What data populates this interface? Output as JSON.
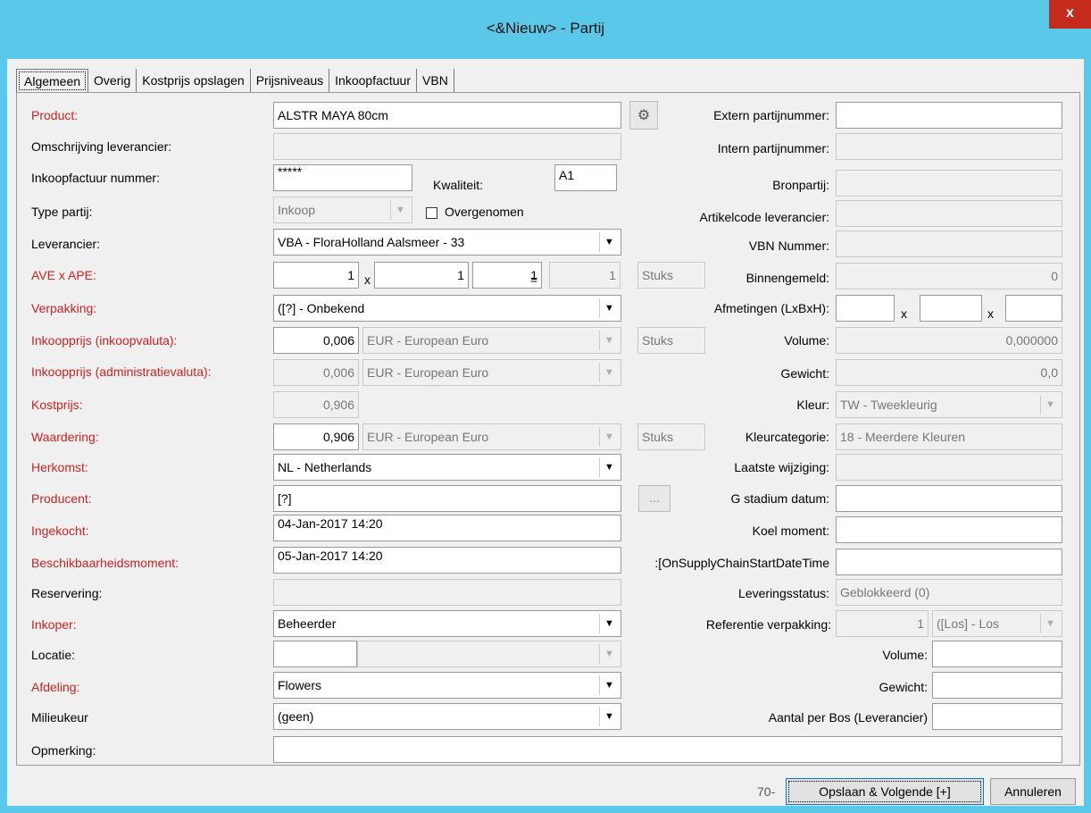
{
  "window": {
    "title": "<&Nieuw> - Partij",
    "close": "x"
  },
  "tabs": [
    "Algemeen",
    "Overig",
    "Kostprijs opslagen",
    "Prijsniveaus",
    "Inkoopfactuur",
    "VBN"
  ],
  "left": {
    "product_label": "Product:",
    "product": "ALSTR MAYA 80cm",
    "omschrijving_label": "Omschrijving leverancier:",
    "omschrijving": "",
    "inkoopfactuur_label": "Inkoopfactuur nummer:",
    "inkoopfactuur": "*****",
    "kwaliteit_label": "Kwaliteit:",
    "kwaliteit": "A1",
    "type_label": "Type partij:",
    "type": "Inkoop",
    "overgenomen": "Overgenomen",
    "leverancier_label": "Leverancier:",
    "leverancier": "VBA - FloraHolland Aalsmeer - 33",
    "ave_label": "AVE x APE:",
    "ave": "1",
    "ave_x": "x",
    "ape": "1",
    "ape2": "1",
    "eq": "=",
    "ave_total": "1",
    "ave_unit": "Stuks",
    "verpakking_label": "Verpakking:",
    "verpakking": "([?] - Onbekend",
    "inkoopprijs_label": "Inkoopprijs (inkoopvaluta):",
    "inkoopprijs": "0,006",
    "inkoopvaluta": "EUR - European Euro",
    "inkoop_unit": "Stuks",
    "inkoopprijs_adm_label": "Inkoopprijs (administratievaluta):",
    "inkoopprijs_adm": "0,006",
    "adm_valuta": "EUR - European Euro",
    "kostprijs_label": "Kostprijs:",
    "kostprijs": "0,906",
    "waardering_label": "Waardering:",
    "waardering": "0,906",
    "waardering_valuta": "EUR - European Euro",
    "waardering_unit": "Stuks",
    "herkomst_label": "Herkomst:",
    "herkomst": "NL - Netherlands",
    "producent_label": "Producent:",
    "producent": "[?]",
    "producent_btn": "...",
    "ingekocht_label": "Ingekocht:",
    "ingekocht": "04-Jan-2017 14:20",
    "beschik_label": "Beschikbaarheidsmoment:",
    "beschik": "05-Jan-2017 14:20",
    "reservering_label": "Reservering:",
    "reservering": "",
    "inkoper_label": "Inkoper:",
    "inkoper": "Beheerder",
    "locatie_label": "Locatie:",
    "locatie": "",
    "locatie2": "",
    "afdeling_label": "Afdeling:",
    "afdeling": "Flowers",
    "milieukeur_label": "Milieukeur",
    "milieukeur": "(geen)",
    "opmerking_label": "Opmerking:",
    "opmerking": ""
  },
  "right": {
    "extern_label": "Extern partijnummer:",
    "extern": "",
    "intern_label": "Intern partijnummer:",
    "intern": "",
    "bron_label": "Bronpartij:",
    "bron": "",
    "artikel_label": "Artikelcode leverancier:",
    "artikel": "",
    "vbn_label": "VBN Nummer:",
    "vbn": "",
    "binnen_label": "Binnengemeld:",
    "binnen": "0",
    "afm_label": "Afmetingen (LxBxH):",
    "afm_x1": "x",
    "afm_x2": "x",
    "afm_l": "",
    "afm_b": "",
    "afm_h": "",
    "volume_label": "Volume:",
    "volume": "0,000000",
    "gewicht_label": "Gewicht:",
    "gewicht": "0,0",
    "kleur_label": "Kleur:",
    "kleur": "TW - Tweekleurig",
    "kleurcat_label": "Kleurcategorie:",
    "kleurcat": "18 - Meerdere Kleuren",
    "laatste_label": "Laatste wijziging:",
    "laatste": "",
    "gstad_label": "G stadium datum:",
    "gstad": "",
    "koel_label": "Koel moment:",
    "koel": "",
    "supply_label": "OnSupplyChainStartDateTime]:",
    "supply": "",
    "lever_label": "Leveringsstatus:",
    "lever": "Geblokkeerd (0)",
    "refverp_label": "Referentie verpakking:",
    "refverp": "1",
    "refverp_type": "([Los] - Los",
    "vol2_label": "Volume:",
    "vol2": "",
    "gew2_label": "Gewicht:",
    "gew2": "",
    "aantal_label": "Aantal per Bos (Leverancier)",
    "aantal": ""
  },
  "footer": {
    "counter": "70-",
    "save": "Opslaan & Volgende [+]",
    "cancel": "Annuleren"
  },
  "colors": {
    "titlebar": "#5ac8e8",
    "required_label": "#cc2222",
    "close": "#c42b1c"
  }
}
